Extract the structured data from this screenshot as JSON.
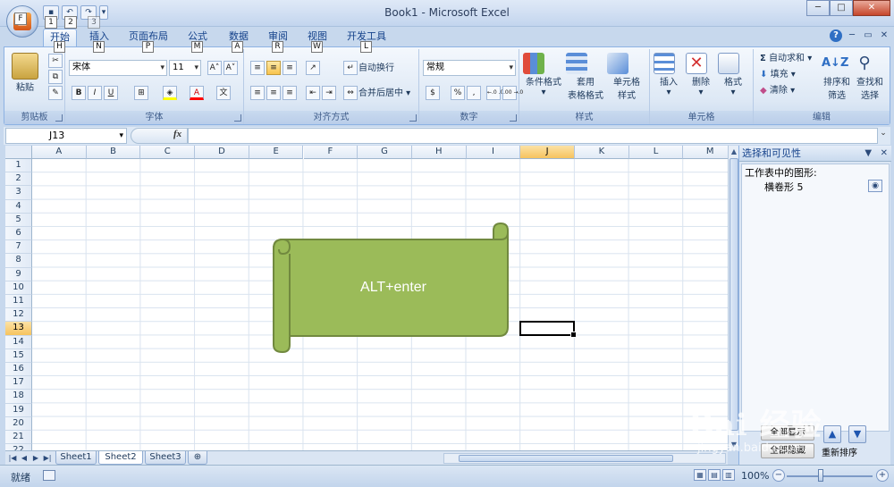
{
  "window": {
    "title": "Book1 - Microsoft Excel",
    "minimize": "─",
    "maximize": "□",
    "close": "✕"
  },
  "quick_access": {
    "keytips": [
      "1",
      "2",
      "3"
    ],
    "office_keytip": "F"
  },
  "ribbon_tabs": [
    {
      "label": "开始",
      "key": "H"
    },
    {
      "label": "插入",
      "key": "N"
    },
    {
      "label": "页面布局",
      "key": "P"
    },
    {
      "label": "公式",
      "key": "M"
    },
    {
      "label": "数据",
      "key": "A"
    },
    {
      "label": "审阅",
      "key": "R"
    },
    {
      "label": "视图",
      "key": "W"
    },
    {
      "label": "开发工具",
      "key": "L"
    }
  ],
  "ribbon_right": {
    "help": "?",
    "minimize": "─",
    "restore": "▭",
    "close": "✕"
  },
  "groups": {
    "clipboard": {
      "label": "剪贴板",
      "paste": "粘贴"
    },
    "font": {
      "label": "字体",
      "font_name": "宋体",
      "font_size": "11",
      "bold": "B",
      "italic": "I",
      "underline": "U",
      "grow": "A˄",
      "shrink": "A˅",
      "font_color": "A",
      "phonetic": "文"
    },
    "alignment": {
      "label": "对齐方式",
      "wrap_text": "自动换行",
      "merge_center": "合并后居中"
    },
    "number": {
      "label": "数字",
      "format": "常规",
      "percent": "%",
      "comma": ",",
      "inc_decimal": "←.0 .00",
      "dec_decimal": ".00 →.0"
    },
    "styles": {
      "label": "样式",
      "conditional": "条件格式",
      "table_format_1": "套用",
      "table_format_2": "表格格式",
      "cell_style_1": "单元格",
      "cell_style_2": "样式"
    },
    "cells": {
      "label": "单元格",
      "insert": "插入",
      "delete": "删除",
      "format": "格式"
    },
    "editing": {
      "label": "编辑",
      "autosum": "自动求和",
      "fill": "填充",
      "clear": "清除",
      "sort_1": "排序和",
      "sort_2": "筛选",
      "find_1": "查找和",
      "find_2": "选择"
    }
  },
  "formula_bar": {
    "name_box": "J13",
    "fx": "fx",
    "formula": ""
  },
  "grid": {
    "columns": [
      "A",
      "B",
      "C",
      "D",
      "E",
      "F",
      "G",
      "H",
      "I",
      "J",
      "K",
      "L",
      "M"
    ],
    "selected_column": "J",
    "rows": [
      "1",
      "2",
      "3",
      "4",
      "5",
      "6",
      "7",
      "8",
      "9",
      "10",
      "11",
      "12",
      "13",
      "14",
      "15",
      "16",
      "17",
      "18",
      "19",
      "20",
      "21",
      "22"
    ],
    "selected_row": "13"
  },
  "shape": {
    "text": "ALT+enter",
    "fill": "#9bbb59",
    "stroke": "#71893f"
  },
  "sheets": [
    "Sheet1",
    "Sheet2",
    "Sheet3"
  ],
  "active_sheet": "Sheet2",
  "task_pane": {
    "title": "选择和可见性",
    "subtitle": "工作表中的图形:",
    "shape_name": "横卷形 5",
    "show_all": "全部显示",
    "hide_all": "全部隐藏",
    "reorder": "重新排序"
  },
  "status": {
    "mode": "就绪",
    "zoom": "100%"
  },
  "watermark": {
    "brand": "Bai 经验",
    "url": "jingyan.baidu.com"
  }
}
